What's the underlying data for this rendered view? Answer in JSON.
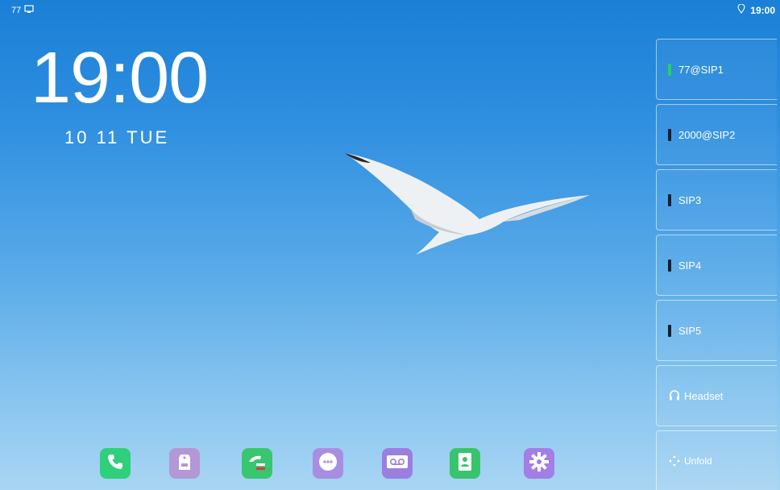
{
  "status_bar": {
    "account_number": "77",
    "time": "19:00"
  },
  "home": {
    "clock": "19:00",
    "date": "10 11 TUE"
  },
  "line_keys": [
    {
      "label": "77@SIP1",
      "status": "registered",
      "indicator_color": "#27d15e"
    },
    {
      "label": "2000@SIP2",
      "status": "idle",
      "indicator_color": "#1a1f2b"
    },
    {
      "label": "SIP3",
      "status": "idle",
      "indicator_color": "#1a1f2b"
    },
    {
      "label": "SIP4",
      "status": "idle",
      "indicator_color": "#1a1f2b"
    },
    {
      "label": "SIP5",
      "status": "idle",
      "indicator_color": "#1a1f2b"
    }
  ],
  "function_keys": {
    "headset": {
      "label": "Headset",
      "icon": "headset-icon"
    },
    "unfold": {
      "label": "Unfold",
      "icon": "unfold-icon"
    }
  },
  "dock": [
    {
      "name": "dial",
      "icon": "phone-icon",
      "color": "#2fcf7b"
    },
    {
      "name": "message",
      "icon": "message-tag-icon",
      "color": "#b497d6"
    },
    {
      "name": "call-history",
      "icon": "call-log-icon",
      "color": "#39c671"
    },
    {
      "name": "apps",
      "icon": "app-grid-icon",
      "color": "#a88ee0"
    },
    {
      "name": "voicemail",
      "icon": "voicemail-icon",
      "color": "#9a7fe0"
    },
    {
      "name": "directory",
      "icon": "contacts-icon",
      "color": "#38c46e"
    },
    {
      "name": "settings",
      "icon": "gear-icon",
      "color": "#a27ee6"
    }
  ]
}
